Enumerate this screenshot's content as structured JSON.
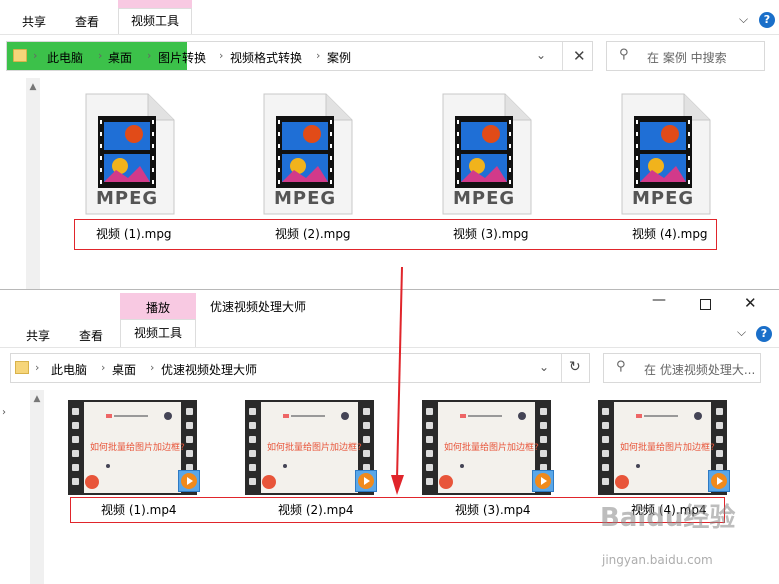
{
  "top_window": {
    "ribbon": {
      "tab_share": "共享",
      "tab_view": "查看",
      "tab_video_tools": "视频工具"
    },
    "breadcrumbs": [
      "此电脑",
      "桌面",
      "图片转换",
      "视频格式转换",
      "案例"
    ],
    "search_placeholder": "在 案例 中搜索",
    "files": [
      {
        "name": "视频 (1).mpg",
        "icon_label": "MPEG"
      },
      {
        "name": "视频 (2).mpg",
        "icon_label": "MPEG"
      },
      {
        "name": "视频 (3).mpg",
        "icon_label": "MPEG"
      },
      {
        "name": "视频 (4).mpg",
        "icon_label": "MPEG"
      }
    ]
  },
  "bottom_window": {
    "context_tab": "播放",
    "title": "优速视频处理大师",
    "ribbon": {
      "tab_share": "共享",
      "tab_view": "查看",
      "tab_video_tools": "视频工具"
    },
    "breadcrumbs": [
      "此电脑",
      "桌面",
      "优速视频处理大师"
    ],
    "search_placeholder": "在 优速视频处理大...",
    "thumbnail_text": "如何批量给图片加边框?",
    "files": [
      {
        "name": "视频 (1).mp4"
      },
      {
        "name": "视频 (2).mp4"
      },
      {
        "name": "视频 (3).mp4"
      },
      {
        "name": "视频 (4).mp4"
      }
    ]
  },
  "watermark": {
    "brand": "Baidu经验",
    "url": "jingyan.baidu.com"
  },
  "colors": {
    "highlight_green": "#3cc14a",
    "context_pink": "#f8c9e2",
    "annotation_red": "#e0252b"
  }
}
